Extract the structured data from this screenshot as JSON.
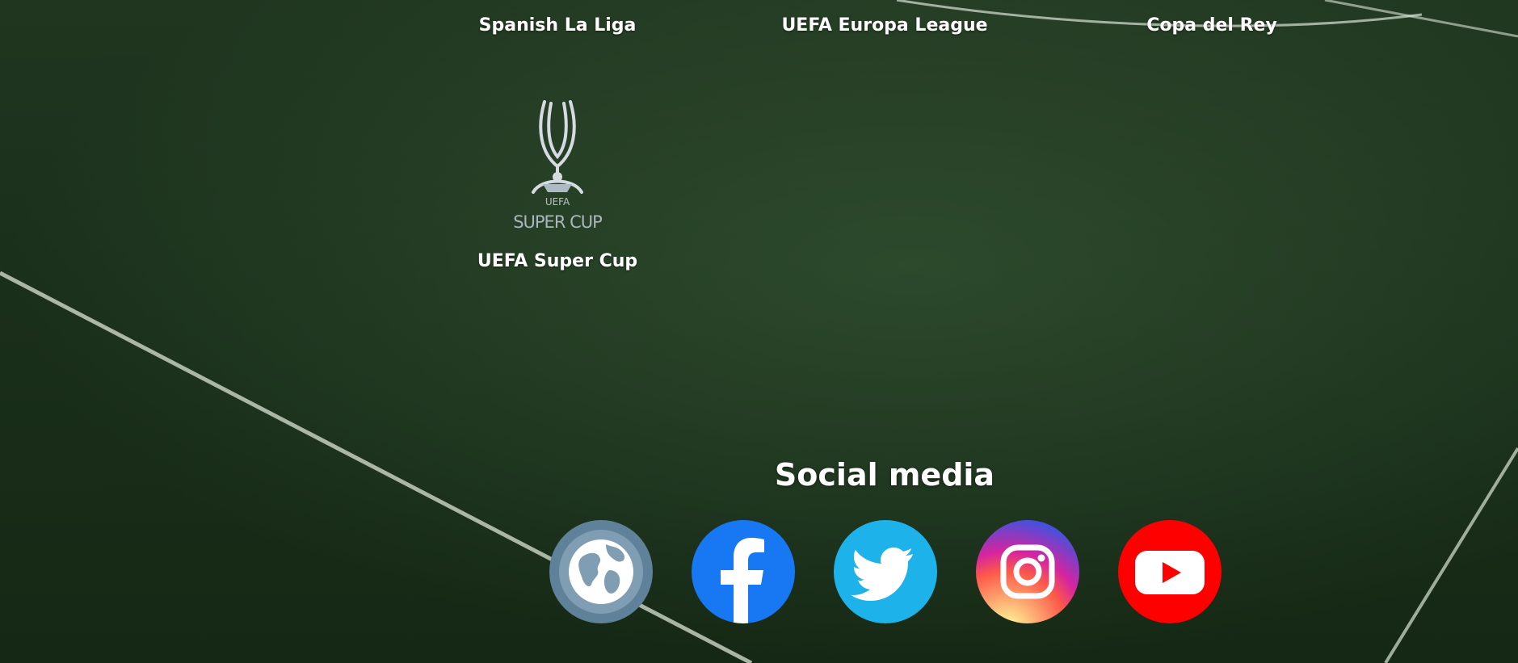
{
  "trophies": {
    "top_row": [
      {
        "label": "Spanish La Liga"
      },
      {
        "label": "UEFA Europa League"
      },
      {
        "label": "Copa del Rey"
      }
    ],
    "super_cup": {
      "label": "UEFA Super Cup",
      "logo_top": "UEFA",
      "logo_bottom": "SUPER CUP",
      "icon": "super-cup-trophy-icon"
    }
  },
  "social": {
    "title": "Social media",
    "links": [
      {
        "name": "website",
        "icon": "globe-icon",
        "color": "#5f8199"
      },
      {
        "name": "facebook",
        "icon": "facebook-icon",
        "color": "#1877f2"
      },
      {
        "name": "twitter",
        "icon": "twitter-icon",
        "color": "#1da1f2"
      },
      {
        "name": "instagram",
        "icon": "instagram-icon",
        "color": "#d6249f"
      },
      {
        "name": "youtube",
        "icon": "youtube-icon",
        "color": "#ff0000"
      }
    ]
  }
}
